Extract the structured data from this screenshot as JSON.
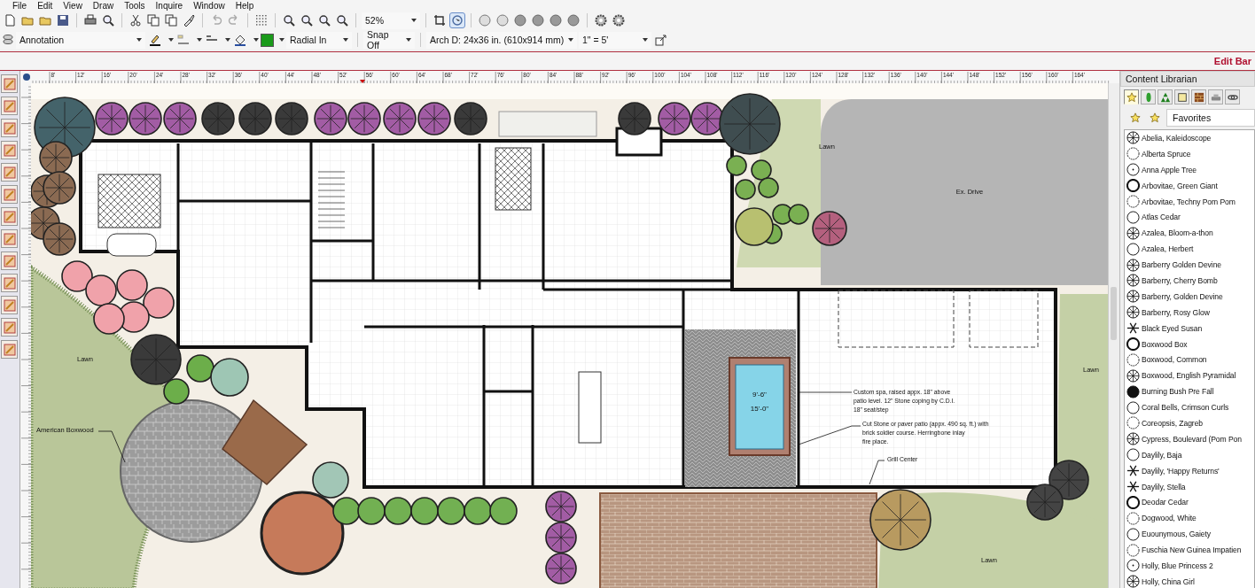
{
  "menu": [
    "File",
    "Edit",
    "View",
    "Draw",
    "Tools",
    "Inquire",
    "Window",
    "Help"
  ],
  "toolbar": {
    "zoom": "52%"
  },
  "format_bar": {
    "layer": "Annotation",
    "fill_style": "Radial In",
    "snap": "Snap Off",
    "sheet": "Arch D: 24x36 in. (610x914 mm)",
    "scale": "1\" = 5'"
  },
  "edit_bar": {
    "label": "Edit Bar"
  },
  "ruler": {
    "marks": [
      "8'",
      "12'",
      "16'",
      "20'",
      "24'",
      "28'",
      "32'",
      "36'",
      "40'",
      "44'",
      "48'",
      "52'",
      "56'",
      "60'",
      "64'",
      "68'",
      "72'",
      "76'",
      "80'",
      "84'",
      "88'",
      "92'",
      "96'",
      "100'",
      "104'",
      "108'",
      "112'",
      "116'",
      "120'",
      "124'",
      "128'",
      "132'",
      "136'",
      "140'",
      "144'",
      "148'",
      "152'",
      "156'",
      "160'",
      "164'"
    ]
  },
  "plan": {
    "labels": [
      "Lawn",
      "Ex. Drive",
      "Lawn",
      "Lawn",
      "Lawn",
      "American Boxwood"
    ],
    "spa": {
      "width": "9'-6\"",
      "length": "15'-0\""
    },
    "notes": [
      "Custom spa, raised appx. 18\" above",
      "patio level.  12\" Stone coping by C.D.I.",
      "18\" seat/step",
      "Cut Stone or paver patio (appx. 490 sq. ft.) with",
      "brick soldier course.  Herringbone inlay",
      "fire place.",
      "Grill Center"
    ]
  },
  "library": {
    "title": "Content Librarian",
    "tabs": [
      {
        "selected": true
      },
      {
        "selected": false
      },
      {
        "selected": false
      },
      {
        "selected": false
      },
      {
        "selected": false
      },
      {
        "selected": false
      },
      {
        "selected": false
      }
    ],
    "category": "Favorites",
    "items": [
      "Abelia, Kaleidoscope",
      "Alberta Spruce",
      "Anna Apple Tree",
      "Arbovitae, Green Giant",
      "Arbovitae, Techny Pom Pom",
      "Atlas Cedar",
      "Azalea, Bloom-a-thon",
      "Azalea, Herbert",
      "Barberry Golden Devine",
      "Barberry, Cherry Bomb",
      "Barberry, Golden Devine",
      "Barberry, Rosy Glow",
      "Black Eyed Susan",
      "Boxwood Box",
      "Boxwood, Common",
      "Boxwood, English Pyramidal",
      "Burning Bush Pre Fall",
      "Coral Bells, Crimson Curls",
      "Coreopsis, Zagreb",
      "Cypress, Boulevard (Pom Pon",
      "Daylily, Baja",
      "Daylily, 'Happy Returns'",
      "Daylily, Stella",
      "Deodar Cedar",
      "Dogwood, White",
      "Euounymous, Gaiety",
      "Fuschia New Guinea Impatien",
      "Holly, Blue Princess 2",
      "Holly, China Girl"
    ]
  }
}
